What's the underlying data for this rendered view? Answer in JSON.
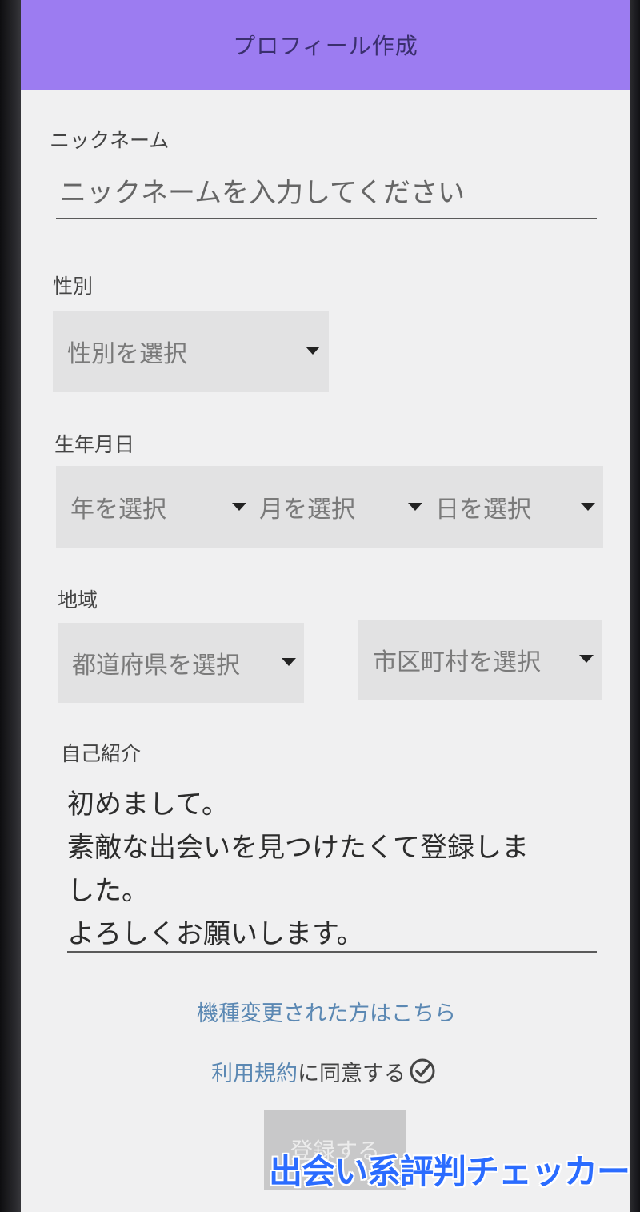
{
  "header": {
    "title": "プロフィール作成"
  },
  "nickname": {
    "label": "ニックネーム",
    "placeholder": "ニックネームを入力してください"
  },
  "gender": {
    "label": "性別",
    "select_value": "性別を選択"
  },
  "birthday": {
    "label": "生年月日",
    "year_value": "年を選択",
    "month_value": "月を選択",
    "day_value": "日を選択"
  },
  "region": {
    "label": "地域",
    "prefecture_value": "都道府県を選択",
    "city_value": "市区町村を選択"
  },
  "bio": {
    "label": "自己紹介",
    "value": "初めまして。\n素敵な出会いを見つけたくて登録しま\nした。\nよろしくお願いします。"
  },
  "links": {
    "device_change": "機種変更された方はこちら"
  },
  "terms": {
    "link_text": "利用規約",
    "agree_text": "に同意する",
    "icon": "check-circle-icon",
    "checked": true
  },
  "register_button": {
    "label": "登録する"
  },
  "watermark": {
    "text": "出会い系評判チェッカー"
  },
  "colors": {
    "app_bar": "#9c7cf1",
    "link": "#5b88b3",
    "select_bg": "#e2e2e3",
    "watermark": "#2b6cff"
  }
}
